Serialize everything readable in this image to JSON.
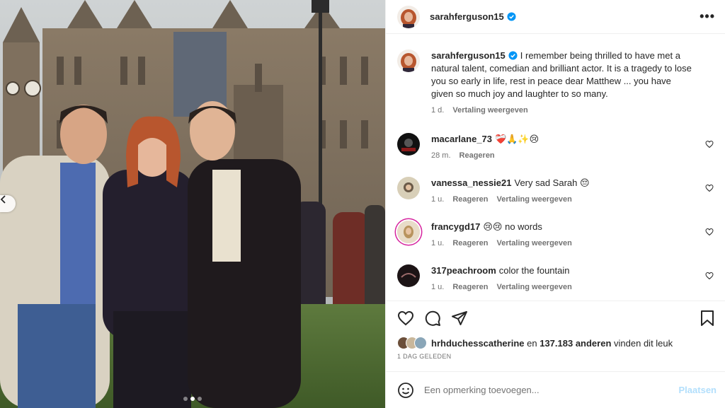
{
  "post": {
    "username": "sarahferguson15",
    "verified": true,
    "more_icon": "more-horizontal-icon"
  },
  "media": {
    "total_slides": 3,
    "active_slide": 1
  },
  "caption": {
    "username": "sarahferguson15",
    "text": "I remember being thrilled to have met a natural talent, comedian and brilliant actor. It is a tragedy to lose you so early in life, rest in peace dear Matthew ... you have given so much joy and laughter to so many.",
    "time": "1 d.",
    "translate": "Vertaling weergeven"
  },
  "comments": [
    {
      "username": "macarlane_73",
      "text": "❤️‍🩹🙏✨😢",
      "time": "28 m.",
      "reply": "Reageren",
      "translate": ""
    },
    {
      "username": "vanessa_nessie21",
      "text": "Very sad Sarah 😔",
      "time": "1 u.",
      "reply": "Reageren",
      "translate": "Vertaling weergeven"
    },
    {
      "username": "francygd17",
      "text": "😢😢 no words",
      "time": "1 u.",
      "reply": "Reageren",
      "translate": "Vertaling weergeven"
    },
    {
      "username": "317peachroom",
      "text": "color the fountain",
      "time": "1 u.",
      "reply": "Reageren",
      "translate": "Vertaling weergeven"
    }
  ],
  "likes": {
    "first_liker": "hrhduchesscatherine",
    "connector": "en",
    "others": "137.183 anderen",
    "suffix": "vinden dit leuk"
  },
  "date": "1 DAG GELEDEN",
  "add_comment": {
    "placeholder": "Een opmerking toevoegen...",
    "post_label": "Plaatsen"
  },
  "colors": {
    "verified": "#0095f6",
    "heart_emoji": "#d0021b",
    "post_button_disabled": "#b2dffc",
    "muted_text": "#737373"
  }
}
